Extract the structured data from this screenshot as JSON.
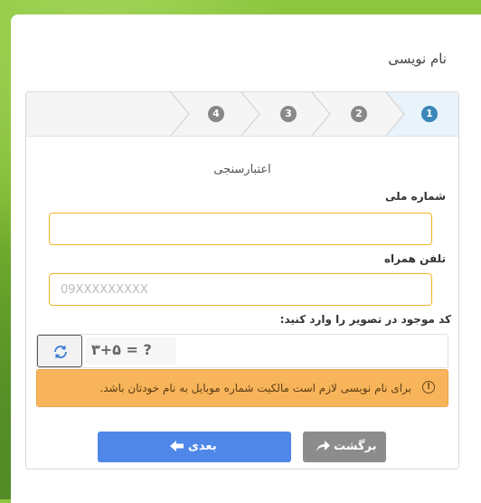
{
  "page": {
    "title": "نام نویسی"
  },
  "wizard": {
    "steps": [
      "1",
      "2",
      "3",
      "4"
    ],
    "active_step": 1,
    "colors": {
      "active": "#3a87b8",
      "inactive": "#888888"
    }
  },
  "form": {
    "section_title": "اعتبارسنجی",
    "national_id": {
      "label": "شماره ملی",
      "value": "",
      "placeholder": ""
    },
    "mobile": {
      "label": "تلفن همراه",
      "value": "",
      "placeholder": "09XXXXXXXXX"
    },
    "captcha": {
      "label": "کد موجود در تصویر را وارد کنید:",
      "image_text": "۳+۵ = ?",
      "value": "",
      "refresh_icon": "refresh-icon"
    }
  },
  "alert": {
    "text": "برای نام نویسی لازم است مالکیت شماره موبایل به نام خودتان باشد.",
    "icon": "info-icon",
    "color": "#f8b45a"
  },
  "buttons": {
    "next_label": "بعدی",
    "back_label": "برگشت",
    "next_color": "#4f87e9",
    "back_color": "#8c8c8c"
  }
}
